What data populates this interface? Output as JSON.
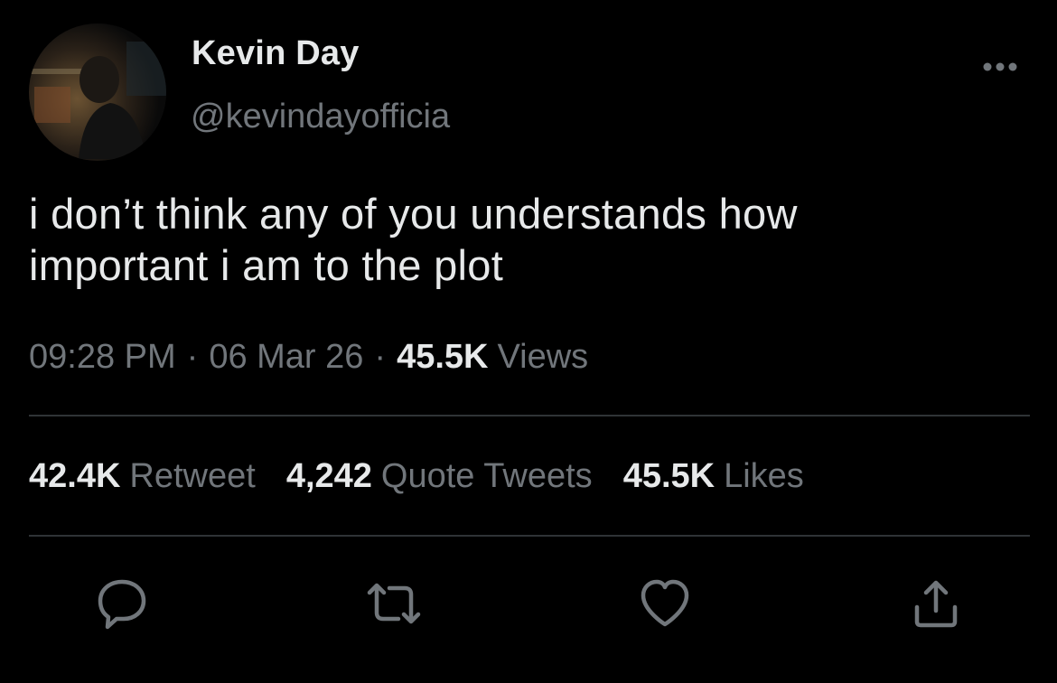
{
  "user": {
    "display_name": "Kevin Day",
    "handle": "@kevindayofficia"
  },
  "tweet": {
    "text_line1": "i don’t think any of you understands how",
    "text_line2": "important i am to the plot",
    "time": "09:28 PM",
    "separator": "·",
    "date": "06 Mar 26",
    "views_count": "45.5K",
    "views_label": "Views"
  },
  "stats": {
    "retweets_count": "42.4K",
    "retweets_label": "Retweet",
    "quotes_count": "4,242",
    "quotes_label": "Quote Tweets",
    "likes_count": "45.5K",
    "likes_label": "Likes"
  },
  "icons": {
    "more": "more-horizontal-icon",
    "reply": "reply-bubble-icon",
    "retweet": "retweet-icon",
    "like": "heart-icon",
    "share": "share-upload-icon"
  },
  "colors": {
    "background": "#000000",
    "primary_text": "#e7e9ea",
    "secondary_text": "#71767b",
    "divider": "#2f3336"
  }
}
